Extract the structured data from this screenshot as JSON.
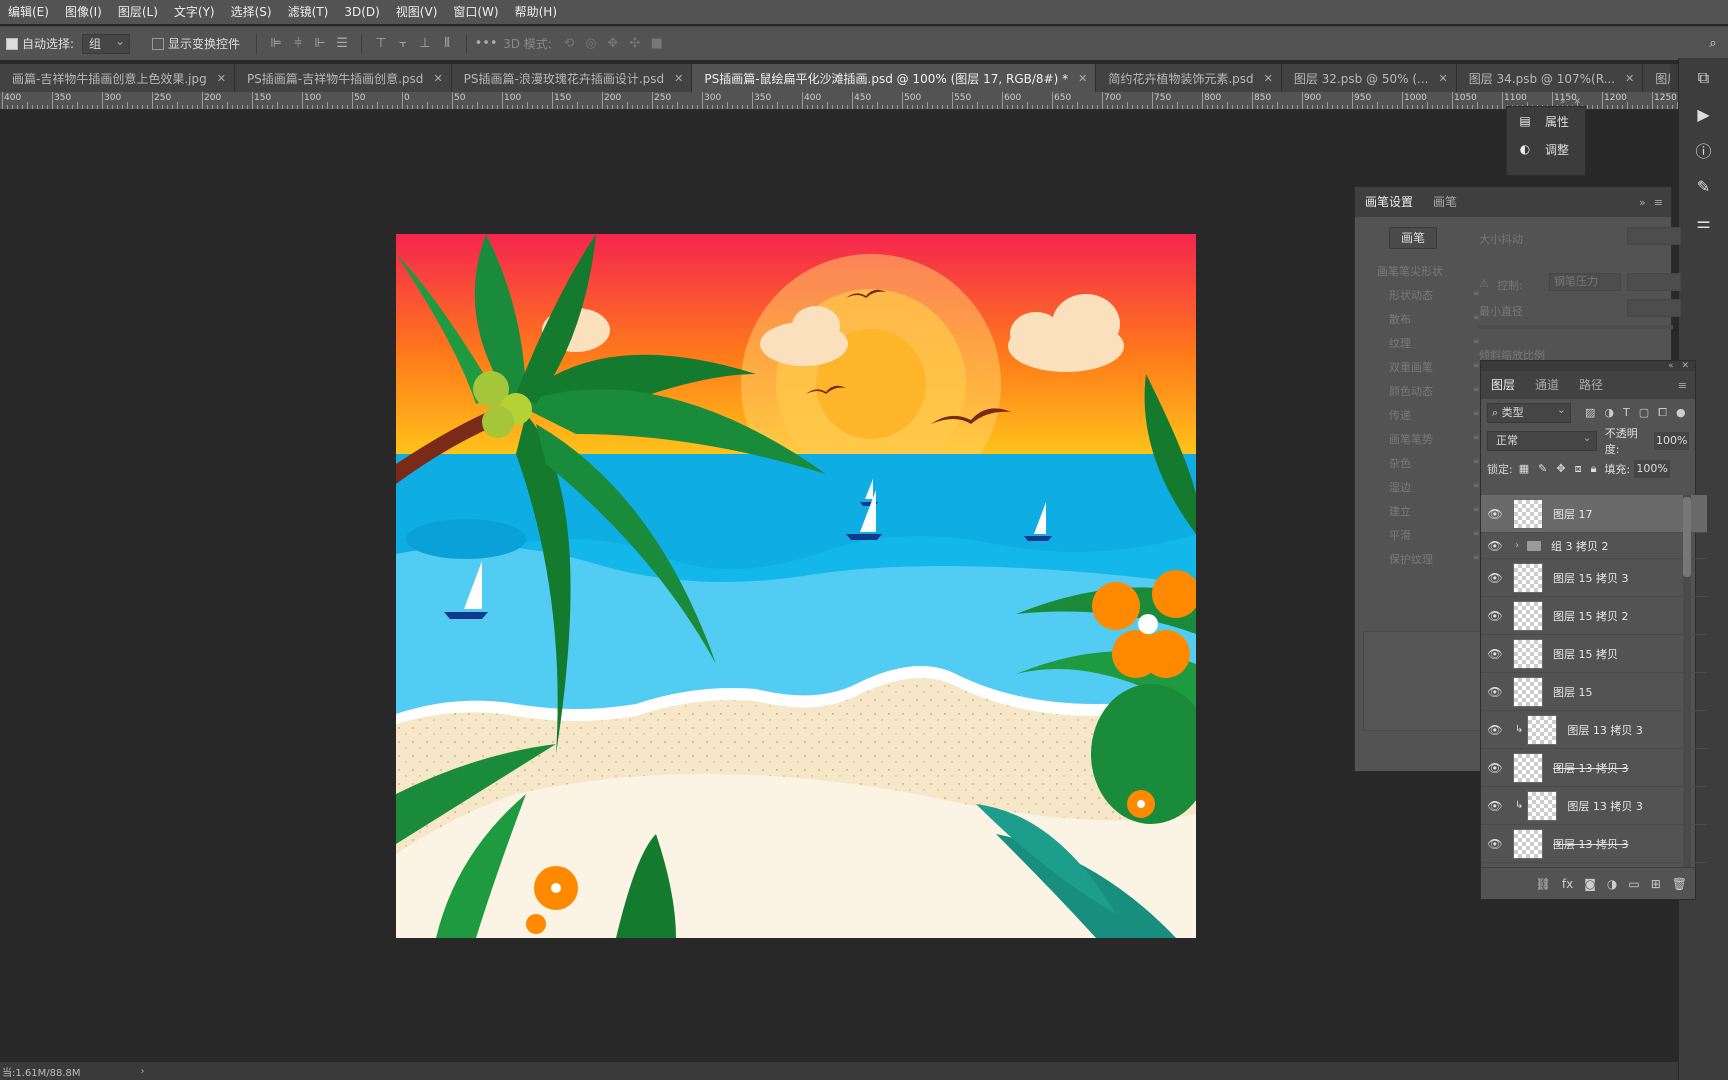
{
  "menu": [
    "编辑(E)",
    "图像(I)",
    "图层(L)",
    "文字(Y)",
    "选择(S)",
    "滤镜(T)",
    "3D(D)",
    "视图(V)",
    "窗口(W)",
    "帮助(H)"
  ],
  "options": {
    "auto_select_label": "自动选择:",
    "auto_select_value": "组",
    "show_transform_label": "显示变换控件",
    "more": "•••",
    "mode_3d": "3D 模式:"
  },
  "tabs": [
    {
      "label": "画篇-吉祥物牛插画创意上色效果.jpg",
      "active": false
    },
    {
      "label": "PS插画篇-吉祥物牛插画创意.psd",
      "active": false
    },
    {
      "label": "PS插画篇-浪漫玫瑰花卉插画设计.psd",
      "active": false
    },
    {
      "label": "PS插画篇-鼠绘扁平化沙滩插画.psd @ 100% (图层 17, RGB/8#) *",
      "active": true
    },
    {
      "label": "简约花卉植物装饰元素.psd",
      "active": false
    },
    {
      "label": "图层 32.psb @ 50% (...",
      "active": false
    },
    {
      "label": "图层 34.psb @ 107%(R...",
      "active": false
    },
    {
      "label": "图层",
      "active": false
    }
  ],
  "ruler_labels": [
    "400",
    "350",
    "300",
    "250",
    "200",
    "150",
    "100",
    "50",
    "0",
    "50",
    "100",
    "150",
    "200",
    "250",
    "300",
    "350",
    "400",
    "450",
    "500",
    "550",
    "600",
    "650",
    "700",
    "750",
    "800",
    "850",
    "900",
    "950",
    "1000",
    "1050",
    "1100",
    "1150",
    "1200",
    "1250"
  ],
  "props_popup": {
    "properties": "属性",
    "adjustments": "调整"
  },
  "brush_panel": {
    "tabs": [
      "画笔设置",
      "画笔"
    ],
    "brush_button": "画笔",
    "section_header": "画笔笔尖形状",
    "options": [
      "形状动态",
      "散布",
      "纹理",
      "双重画笔",
      "颜色动态",
      "传递",
      "画笔笔势",
      "杂色",
      "湿边",
      "建立",
      "平滑",
      "保护纹理"
    ],
    "size_jitter": "大小抖动",
    "control_label": "控制:",
    "control_value": "钢笔压力",
    "min_diameter": "最小直径",
    "tilt_scale": "倾斜缩放比例"
  },
  "layers_panel": {
    "tabs": [
      "图层",
      "通道",
      "路径"
    ],
    "filter_label": "类型",
    "blend_mode": "正常",
    "opacity_label": "不透明度:",
    "opacity_value": "100%",
    "lock_label": "锁定:",
    "fill_label": "填充:",
    "fill_value": "100%",
    "layers": [
      {
        "name": "图层 17",
        "selected": true,
        "type": "layer",
        "clipped": false,
        "strike": false
      },
      {
        "name": "组 3 拷贝 2",
        "selected": false,
        "type": "group",
        "clipped": false,
        "strike": false
      },
      {
        "name": "图层 15 拷贝 3",
        "selected": false,
        "type": "layer",
        "clipped": false,
        "strike": false
      },
      {
        "name": "图层 15 拷贝 2",
        "selected": false,
        "type": "layer",
        "clipped": false,
        "strike": false
      },
      {
        "name": "图层 15 拷贝",
        "selected": false,
        "type": "layer",
        "clipped": false,
        "strike": false
      },
      {
        "name": "图层 15",
        "selected": false,
        "type": "layer",
        "clipped": false,
        "strike": false
      },
      {
        "name": "图层 13 拷贝 3",
        "selected": false,
        "type": "layer",
        "clipped": true,
        "strike": false
      },
      {
        "name": "图层 13 拷贝 3",
        "selected": false,
        "type": "layer",
        "clipped": false,
        "strike": true
      },
      {
        "name": "图层 13 拷贝 3",
        "selected": false,
        "type": "layer",
        "clipped": true,
        "strike": false
      },
      {
        "name": "图层 13 拷贝 3",
        "selected": false,
        "type": "layer",
        "clipped": false,
        "strike": true
      }
    ]
  },
  "status": {
    "doc_size": "当:1.61M/88.8M"
  },
  "colors": {
    "sky_top": "#F5254F",
    "sky_mid": "#FF7A1A",
    "sky_bottom": "#FFC21A",
    "sea": "#13B7EA",
    "shore": "#F5E6C8",
    "palm_green": "#1A8B3A",
    "flower_orange": "#FF8A00"
  }
}
